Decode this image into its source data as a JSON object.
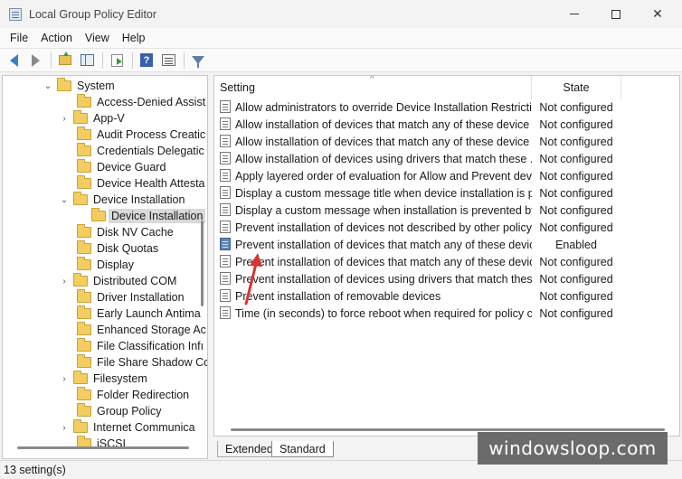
{
  "window": {
    "title": "Local Group Policy Editor"
  },
  "menu": {
    "items": [
      {
        "label": "File"
      },
      {
        "label": "Action"
      },
      {
        "label": "View"
      },
      {
        "label": "Help"
      }
    ]
  },
  "tree": {
    "items": [
      {
        "label": "System",
        "expanded": true
      },
      {
        "label": "Access-Denied Assist"
      },
      {
        "label": "App-V"
      },
      {
        "label": "Audit Process Creatic"
      },
      {
        "label": "Credentials Delegatic"
      },
      {
        "label": "Device Guard"
      },
      {
        "label": "Device Health Attesta"
      },
      {
        "label": "Device Installation",
        "expanded": true
      },
      {
        "label": "Device Installation",
        "selected": true
      },
      {
        "label": "Disk NV Cache"
      },
      {
        "label": "Disk Quotas"
      },
      {
        "label": "Display"
      },
      {
        "label": "Distributed COM"
      },
      {
        "label": "Driver Installation"
      },
      {
        "label": "Early Launch Antima"
      },
      {
        "label": "Enhanced Storage Ac"
      },
      {
        "label": "File Classification Infı"
      },
      {
        "label": "File Share Shadow Co"
      },
      {
        "label": "Filesystem"
      },
      {
        "label": "Folder Redirection"
      },
      {
        "label": "Group Policy"
      },
      {
        "label": "Internet Communica"
      },
      {
        "label": "iSCSI"
      }
    ]
  },
  "table": {
    "headers": {
      "setting": "Setting",
      "state": "State"
    },
    "rows": [
      {
        "setting": "Allow administrators to override Device Installation Restrictic...",
        "state": "Not configured"
      },
      {
        "setting": "Allow installation of devices that match any of these device ...",
        "state": "Not configured"
      },
      {
        "setting": "Allow installation of devices that match any of these device ...",
        "state": "Not configured"
      },
      {
        "setting": "Allow installation of devices using drivers that match these ...",
        "state": "Not configured"
      },
      {
        "setting": "Apply layered order of evaluation for Allow and Prevent devi...",
        "state": "Not configured"
      },
      {
        "setting": "Display a custom message title when device installation is pr...",
        "state": "Not configured"
      },
      {
        "setting": "Display a custom message when installation is prevented by...",
        "state": "Not configured"
      },
      {
        "setting": "Prevent installation of devices not described by other policy ...",
        "state": "Not configured"
      },
      {
        "setting": "Prevent installation of devices that match any of these devic...",
        "state": "Enabled"
      },
      {
        "setting": "Prevent installation of devices that match any of these devic...",
        "state": "Not configured"
      },
      {
        "setting": "Prevent installation of devices using drivers that match thes...",
        "state": "Not configured"
      },
      {
        "setting": "Prevent installation of removable devices",
        "state": "Not configured"
      },
      {
        "setting": "Time (in seconds) to force reboot when required for policy c...",
        "state": "Not configured"
      }
    ]
  },
  "tabs": {
    "extended": "Extended",
    "standard": "Standard"
  },
  "status": {
    "text": "13 setting(s)"
  },
  "watermark": {
    "text": "windowsloop.com"
  },
  "colors": {
    "annotation_arrow": "#d93434"
  }
}
